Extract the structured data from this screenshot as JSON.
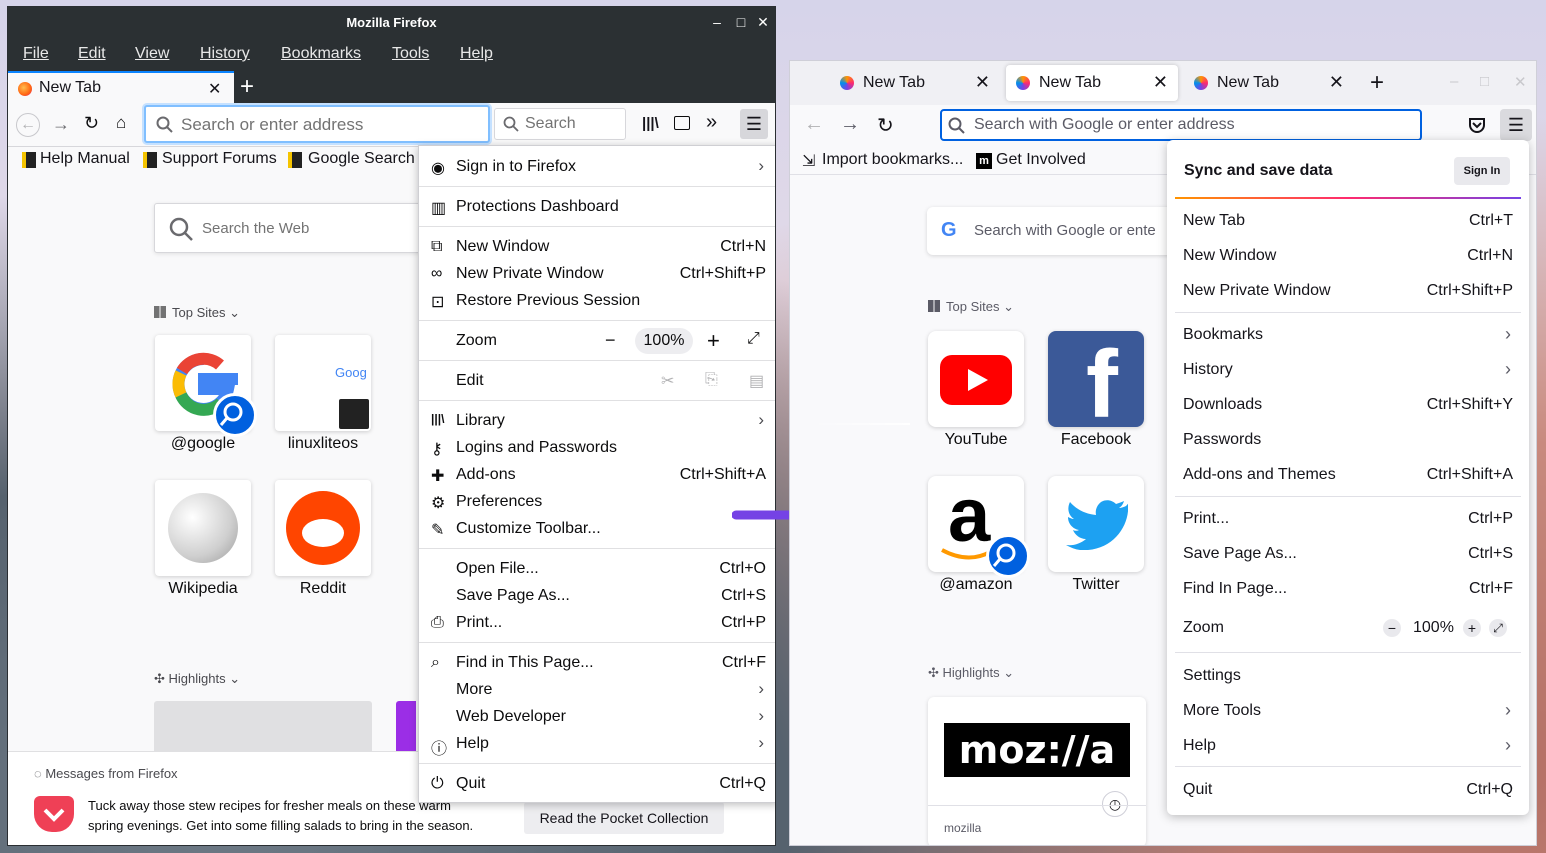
{
  "old_window": {
    "title": "Mozilla Firefox",
    "menubar": [
      "File",
      "Edit",
      "View",
      "History",
      "Bookmarks",
      "Tools",
      "Help"
    ],
    "tab_label": "New Tab",
    "url_placeholder": "Search or enter address",
    "search_placeholder": "Search",
    "bookmarks": [
      "Help Manual",
      "Support Forums",
      "Google Search"
    ],
    "page_search_placeholder": "Search the Web",
    "top_sites_label": "Top Sites",
    "top_sites": [
      "@google",
      "linuxliteos",
      "Wikipedia",
      "Reddit"
    ],
    "highlights_label": "Highlights",
    "messages_label": "Messages from Firefox",
    "message_text_1": "Tuck away those stew recipes for fresher meals on these warm",
    "message_text_2": "spring evenings. Get into some filling salads to bring in the season.",
    "message_button": "Read the Pocket Collection",
    "menu": {
      "sign_in": "Sign in to Firefox",
      "protections": "Protections Dashboard",
      "new_window": "New Window",
      "new_window_sc": "Ctrl+N",
      "new_private": "New Private Window",
      "new_private_sc": "Ctrl+Shift+P",
      "restore": "Restore Previous Session",
      "zoom": "Zoom",
      "zoom_value": "100%",
      "edit": "Edit",
      "library": "Library",
      "logins": "Logins and Passwords",
      "addons": "Add-ons",
      "addons_sc": "Ctrl+Shift+A",
      "preferences": "Preferences",
      "customize": "Customize Toolbar...",
      "open_file": "Open File...",
      "open_file_sc": "Ctrl+O",
      "save_page": "Save Page As...",
      "save_page_sc": "Ctrl+S",
      "print": "Print...",
      "print_sc": "Ctrl+P",
      "find": "Find in This Page...",
      "find_sc": "Ctrl+F",
      "more": "More",
      "web_dev": "Web Developer",
      "help": "Help",
      "quit": "Quit",
      "quit_sc": "Ctrl+Q"
    }
  },
  "new_window": {
    "tabs": [
      "New Tab",
      "New Tab",
      "New Tab"
    ],
    "url_placeholder": "Search with Google or enter address",
    "bookmarks": [
      "Import bookmarks...",
      "Get Involved"
    ],
    "page_search_placeholder": "Search with Google or ente",
    "top_sites_label": "Top Sites",
    "top_sites": [
      "YouTube",
      "Facebook",
      "@amazon",
      "Twitter"
    ],
    "highlights_label": "Highlights",
    "highlight_logo": "moz://a",
    "highlight_caption": "mozilla",
    "menu": {
      "sync_title": "Sync and save data",
      "sign_in": "Sign In",
      "new_tab": "New Tab",
      "new_tab_sc": "Ctrl+T",
      "new_window": "New Window",
      "new_window_sc": "Ctrl+N",
      "new_private": "New Private Window",
      "new_private_sc": "Ctrl+Shift+P",
      "bookmarks": "Bookmarks",
      "history": "History",
      "downloads": "Downloads",
      "downloads_sc": "Ctrl+Shift+Y",
      "passwords": "Passwords",
      "addons": "Add-ons and Themes",
      "addons_sc": "Ctrl+Shift+A",
      "print": "Print...",
      "print_sc": "Ctrl+P",
      "save_page": "Save Page As...",
      "save_page_sc": "Ctrl+S",
      "find": "Find In Page...",
      "find_sc": "Ctrl+F",
      "zoom": "Zoom",
      "zoom_value": "100%",
      "settings": "Settings",
      "more_tools": "More Tools",
      "help": "Help",
      "quit": "Quit",
      "quit_sc": "Ctrl+Q"
    }
  },
  "colors": {
    "accent_old": "#0a84ff",
    "accent_new": "#0061e0",
    "arrow": "#7542e5"
  }
}
